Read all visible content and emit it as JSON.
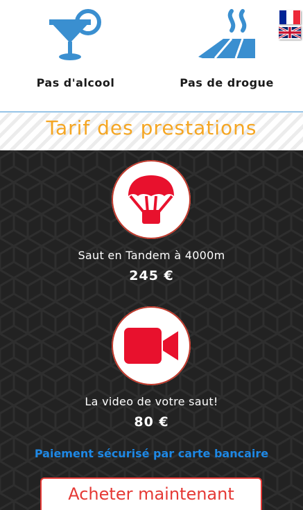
{
  "rules": {
    "no_alcohol": "Pas d'alcool",
    "no_drugs": "Pas de drogue"
  },
  "languages": [
    "fr",
    "en"
  ],
  "section_title": "Tarif des prestations",
  "services": [
    {
      "name": "Saut en Tandem à 4000m",
      "price": "245 €",
      "icon": "parachute-icon"
    },
    {
      "name": "La video de votre saut!",
      "price": "80 €",
      "icon": "video-camera-icon"
    }
  ],
  "payment_note": "Paiement sécurisé par carte bancaire",
  "buy_button": "Acheter maintenant",
  "colors": {
    "accent_blue": "#3a8fd0",
    "title_orange": "#f5a623",
    "red": "#e8112d",
    "dark_bg": "#222222",
    "payment_blue": "#1e88e5"
  }
}
